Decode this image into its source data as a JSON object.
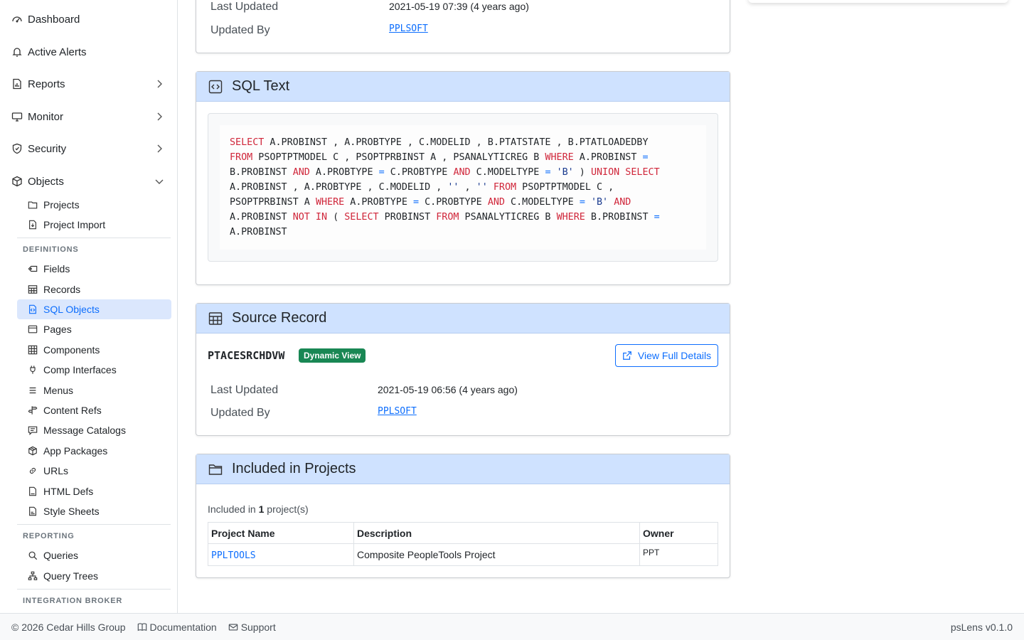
{
  "sidebar": {
    "top_items": [
      {
        "label": "Dashboard"
      },
      {
        "label": "Active Alerts"
      },
      {
        "label": "Reports"
      },
      {
        "label": "Monitor"
      },
      {
        "label": "Security"
      },
      {
        "label": "Objects"
      }
    ],
    "objects_items": [
      {
        "label": "Projects"
      },
      {
        "label": "Project Import"
      }
    ],
    "definitions_label": "DEFINITIONS",
    "definitions_items": [
      {
        "label": "Fields"
      },
      {
        "label": "Records"
      },
      {
        "label": "SQL Objects"
      },
      {
        "label": "Pages"
      },
      {
        "label": "Components"
      },
      {
        "label": "Comp Interfaces"
      },
      {
        "label": "Menus"
      },
      {
        "label": "Content Refs"
      },
      {
        "label": "Message Catalogs"
      },
      {
        "label": "App Packages"
      },
      {
        "label": "URLs"
      },
      {
        "label": "HTML Defs"
      },
      {
        "label": "Style Sheets"
      }
    ],
    "reporting_label": "REPORTING",
    "reporting_items": [
      {
        "label": "Queries"
      },
      {
        "label": "Query Trees"
      }
    ],
    "integration_label": "INTEGRATION BROKER"
  },
  "top_card": {
    "last_updated_label": "Last Updated",
    "last_updated_value": "2021-05-19 07:39 (4 years ago)",
    "updated_by_label": "Updated By",
    "updated_by_value": "PPLSOFT"
  },
  "sql_card": {
    "title": "SQL Text",
    "sql": "SELECT A.PROBINST , A.PROBTYPE , C.MODELID , B.PTATSTATE , B.PTATLOADEDBY FROM PSOPTPTMODEL C , PSOPTPRBINST A , PSANALYTICREG B WHERE A.PROBINST = B.PROBINST AND A.PROBTYPE = C.PROBTYPE AND C.MODELTYPE = 'B' ) UNION SELECT A.PROBINST , A.PROBTYPE , C.MODELID , '' , '' FROM PSOPTPTMODEL C , PSOPTPRBINST A WHERE A.PROBTYPE = C.PROBTYPE AND C.MODELTYPE = 'B' AND A.PROBINST NOT IN ( SELECT PROBINST FROM PSANALYTICREG B WHERE B.PROBINST = A.PROBINST"
  },
  "source_card": {
    "title": "Source Record",
    "record_name": "PTACESRCHDVW",
    "badge": "Dynamic View",
    "view_button": "View Full Details",
    "last_updated_label": "Last Updated",
    "last_updated_value": "2021-05-19 06:56 (4 years ago)",
    "updated_by_label": "Updated By",
    "updated_by_value": "PPLSOFT"
  },
  "projects_card": {
    "title": "Included in Projects",
    "summary_prefix": "Included in ",
    "summary_count": "1",
    "summary_suffix": " project(s)",
    "columns": [
      "Project Name",
      "Description",
      "Owner"
    ],
    "rows": [
      {
        "name": "PPLTOOLS",
        "description": "Composite PeopleTools Project",
        "owner": "PPT"
      }
    ]
  },
  "footer": {
    "copyright": "© 2026 Cedar Hills Group",
    "documentation": "Documentation",
    "support": "Support",
    "version": "psLens v0.1.0"
  },
  "colors": {
    "accent": "#0d6efd",
    "card_header": "#cfe2ff",
    "badge_green": "#198754",
    "sql_keyword": "#d0263a"
  }
}
